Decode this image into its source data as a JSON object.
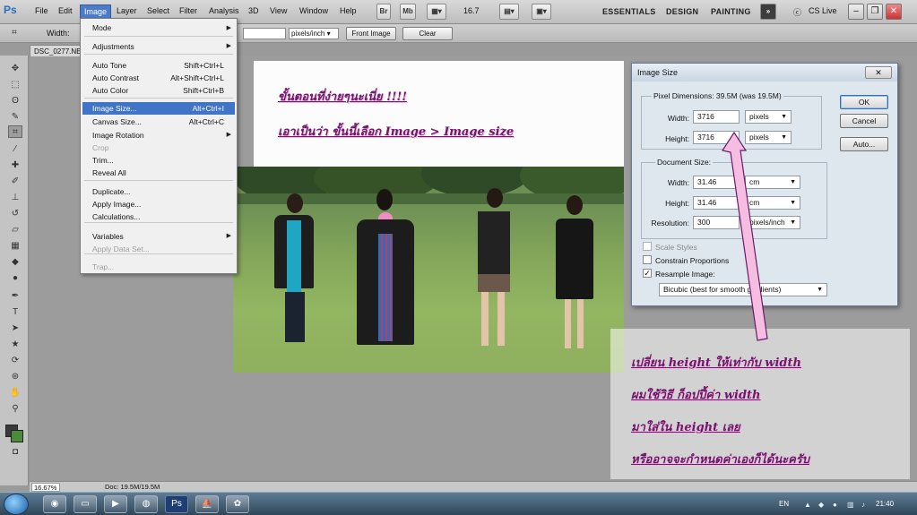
{
  "app": {
    "logo": "Ps",
    "menus": [
      "File",
      "Edit",
      "Image",
      "Layer",
      "Select",
      "Filter",
      "Analysis",
      "3D",
      "View",
      "Window",
      "Help"
    ],
    "active_menu": "Image",
    "toolbar_badges": [
      "Br",
      "Mb"
    ],
    "zoom_value": "16.7",
    "workspaces": [
      "ESSENTIALS",
      "DESIGN",
      "PAINTING"
    ],
    "cs_live": "CS Live"
  },
  "options_bar": {
    "width_label": "Width:",
    "resolution_unit": "pixels/inch",
    "front_image_label": "Front Image",
    "clear_label": "Clear"
  },
  "document": {
    "tab_title": "DSC_0277.NE",
    "zoom_status": "16.67%",
    "doc_info": "Doc: 19.5M/19.5M"
  },
  "image_menu": {
    "items": [
      {
        "label": "Mode",
        "shortcut": "",
        "submenu": true,
        "disabled": false
      },
      {
        "label": "Adjustments",
        "shortcut": "",
        "submenu": true,
        "disabled": false
      },
      {
        "label": "Auto Tone",
        "shortcut": "Shift+Ctrl+L",
        "submenu": false,
        "disabled": false
      },
      {
        "label": "Auto Contrast",
        "shortcut": "Alt+Shift+Ctrl+L",
        "submenu": false,
        "disabled": false
      },
      {
        "label": "Auto Color",
        "shortcut": "Shift+Ctrl+B",
        "submenu": false,
        "disabled": false
      },
      {
        "label": "Image Size...",
        "shortcut": "Alt+Ctrl+I",
        "submenu": false,
        "disabled": false,
        "highlighted": true
      },
      {
        "label": "Canvas Size...",
        "shortcut": "Alt+Ctrl+C",
        "submenu": false,
        "disabled": false
      },
      {
        "label": "Image Rotation",
        "shortcut": "",
        "submenu": true,
        "disabled": false
      },
      {
        "label": "Crop",
        "shortcut": "",
        "submenu": false,
        "disabled": true
      },
      {
        "label": "Trim...",
        "shortcut": "",
        "submenu": false,
        "disabled": false
      },
      {
        "label": "Reveal All",
        "shortcut": "",
        "submenu": false,
        "disabled": false
      },
      {
        "label": "Duplicate...",
        "shortcut": "",
        "submenu": false,
        "disabled": false
      },
      {
        "label": "Apply Image...",
        "shortcut": "",
        "submenu": false,
        "disabled": false
      },
      {
        "label": "Calculations...",
        "shortcut": "",
        "submenu": false,
        "disabled": false
      },
      {
        "label": "Variables",
        "shortcut": "",
        "submenu": true,
        "disabled": false
      },
      {
        "label": "Apply Data Set...",
        "shortcut": "",
        "submenu": false,
        "disabled": true
      },
      {
        "label": "Trap...",
        "shortcut": "",
        "submenu": false,
        "disabled": true
      }
    ]
  },
  "dialog": {
    "title": "Image Size",
    "close_glyph": "✕",
    "pixel_dimensions_label": "Pixel Dimensions:  39.5M (was 19.5M)",
    "pixel_width_label": "Width:",
    "pixel_width_value": "3716",
    "pixel_width_unit": "pixels",
    "pixel_height_label": "Height:",
    "pixel_height_value": "3716",
    "pixel_height_unit": "pixels",
    "document_size_label": "Document Size:",
    "doc_width_label": "Width:",
    "doc_width_value": "31.46",
    "doc_width_unit": "cm",
    "doc_height_label": "Height:",
    "doc_height_value": "31.46",
    "doc_height_unit": "cm",
    "resolution_label": "Resolution:",
    "resolution_value": "300",
    "resolution_unit": "pixels/inch",
    "scale_styles_label": "Scale Styles",
    "scale_styles_checked": false,
    "constrain_label": "Constrain Proportions",
    "constrain_checked": false,
    "resample_label": "Resample Image:",
    "resample_checked": true,
    "resample_method": "Bicubic (best for smooth gradients)",
    "ok_label": "OK",
    "cancel_label": "Cancel",
    "auto_label": "Auto..."
  },
  "annotations": {
    "top_line1": "ขั้นตอนที่ง่ายๆนะเนี่ย !!!!",
    "top_line2": "เอาเป็นว่า ขั้นนี้เลือก Image > Image size",
    "bottom_line1": "เปลี่ยน height ให้เท่ากับ width",
    "bottom_line2": "ผมใช้วิธี ก็อปปี้ค่า width",
    "bottom_line3": "มาใส่ใน height เลย",
    "bottom_line4": "หรืออาจจะกำหนดค่าเองก็ได้นะครับ",
    "text_color": "#6a1a66",
    "arrow_color": "#f0a8d8"
  },
  "taskbar": {
    "language": "EN",
    "clock": "21:40"
  },
  "colors": {
    "foreground_swatch": "#3a3a3a",
    "background_swatch": "#4a8c3a",
    "menu_highlight": "#3f74c6"
  }
}
